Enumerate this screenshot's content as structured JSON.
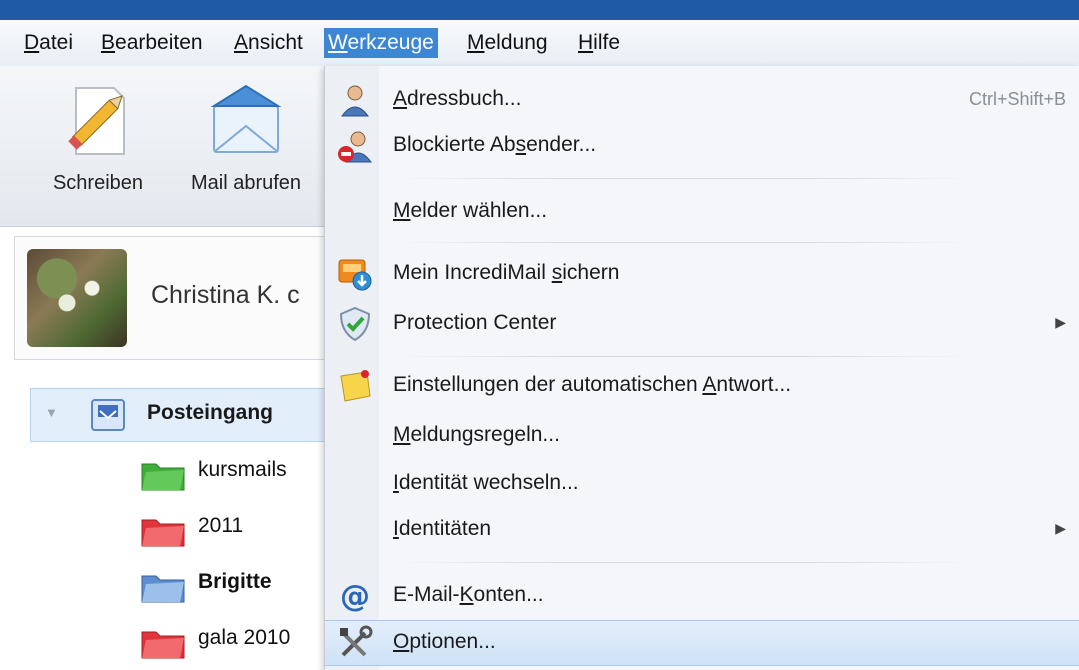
{
  "menubar": {
    "items": [
      {
        "label": "Datei",
        "u": "D",
        "rest": "atei"
      },
      {
        "label": "Bearbeiten",
        "u": "B",
        "rest": "earbeiten"
      },
      {
        "label": "Ansicht",
        "u": "A",
        "rest": "nsicht"
      },
      {
        "label": "Werkzeuge",
        "u": "W",
        "rest": "erkzeuge"
      },
      {
        "label": "Meldung",
        "u": "M",
        "rest": "eldung"
      },
      {
        "label": "Hilfe",
        "u": "H",
        "rest": "ilfe"
      }
    ]
  },
  "toolbar": {
    "compose_label": "Schreiben",
    "fetch_label": "Mail abrufen"
  },
  "profile": {
    "name": "Christina K. c"
  },
  "folders": {
    "inbox": "Posteingang",
    "f1": "kursmails",
    "f2": "2011",
    "f3": "Brigitte",
    "f4": "gala 2010"
  },
  "dropdown": {
    "adressbuch": {
      "pre": "",
      "u": "A",
      "post": "dressbuch...",
      "shortcut": "Ctrl+Shift+B"
    },
    "blockiert": {
      "pre": "Blockierte Ab",
      "u": "s",
      "post": "ender..."
    },
    "melder": {
      "pre": "",
      "u": "M",
      "post": "elder wählen..."
    },
    "sichern": {
      "pre": "Mein IncrediMail ",
      "u": "s",
      "post": "ichern"
    },
    "protection": {
      "label": "Protection Center"
    },
    "autoantwort": {
      "pre": "Einstellungen der automatischen ",
      "u": "A",
      "post": "ntwort..."
    },
    "regeln": {
      "pre": "",
      "u": "M",
      "post": "eldungsregeln..."
    },
    "wechseln": {
      "pre": "",
      "u": "I",
      "post": "dentität wechseln..."
    },
    "identitaeten": {
      "pre": "",
      "u": "I",
      "post": "dentitäten"
    },
    "konten": {
      "pre": "E-Mail-",
      "u": "K",
      "post": "onten..."
    },
    "optionen": {
      "pre": "",
      "u": "O",
      "post": "ptionen..."
    }
  },
  "colors": {
    "accent": "#3c86d3",
    "titlebar": "#1f5aa6",
    "hover": "#cfe2f7"
  }
}
